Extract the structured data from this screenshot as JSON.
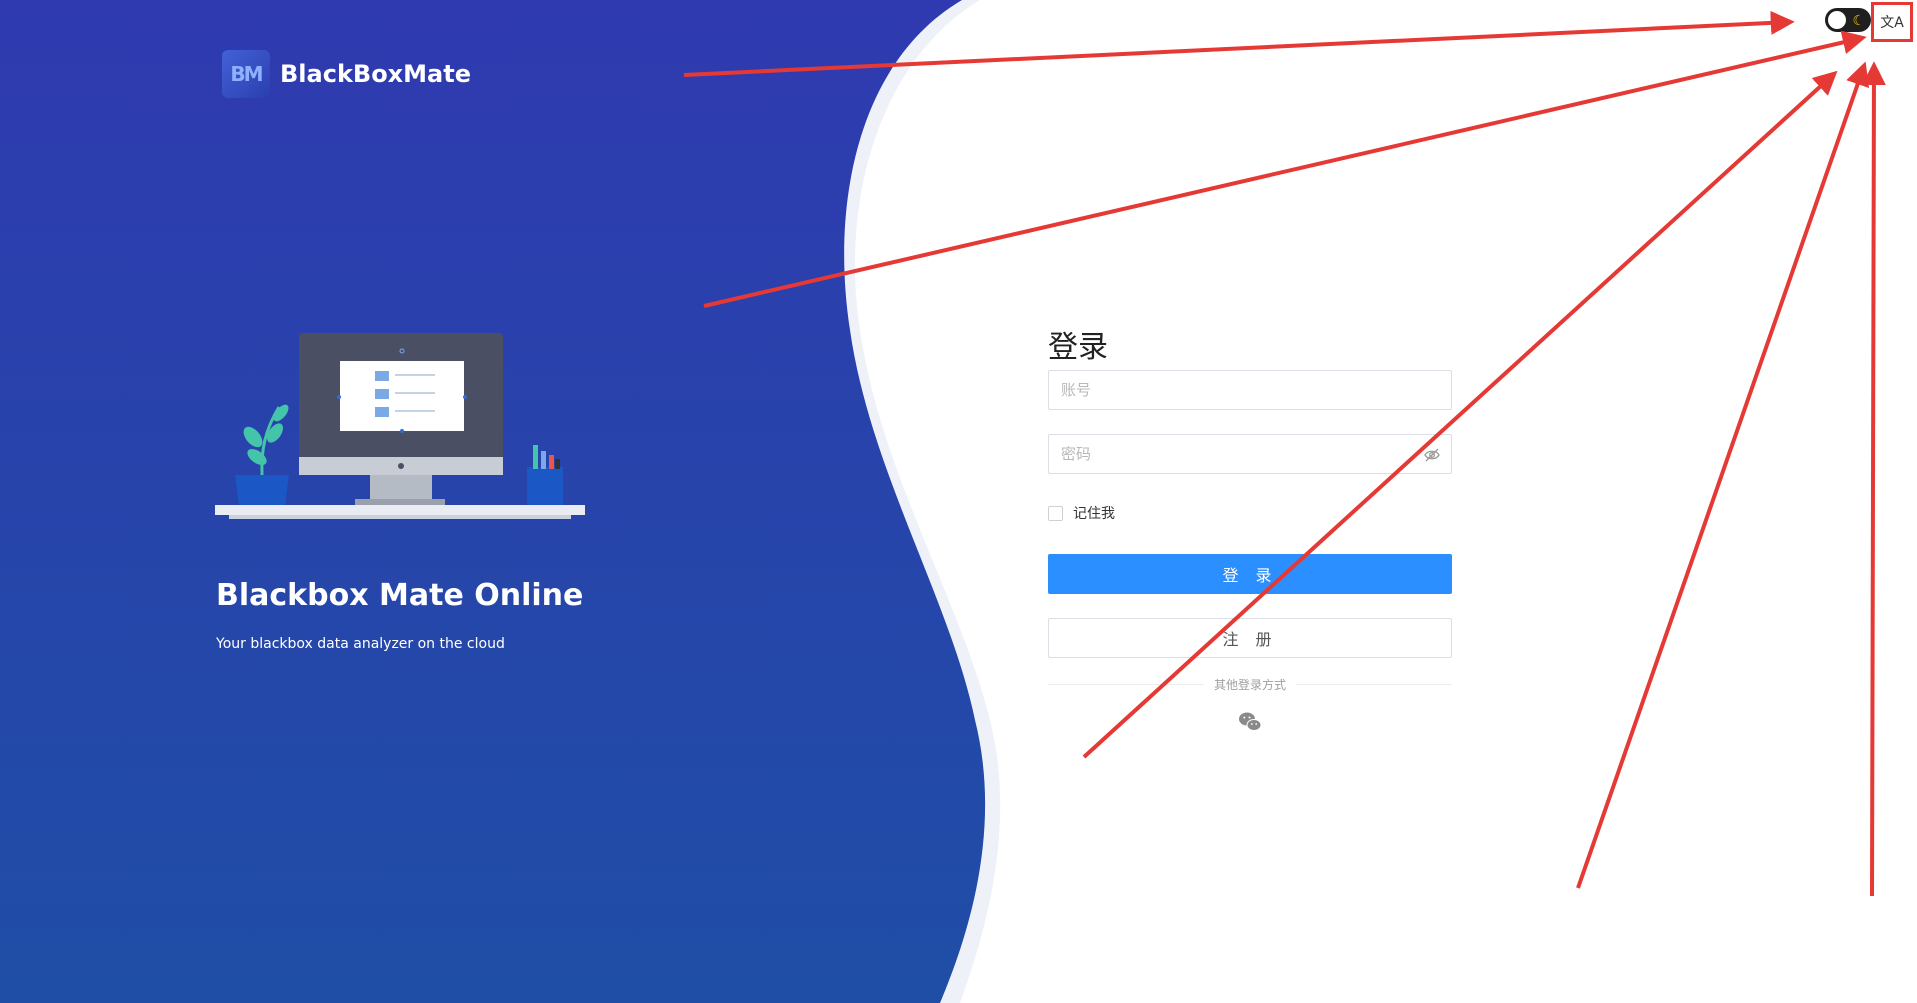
{
  "brand": {
    "logo_text": "BM",
    "name": "BlackBoxMate"
  },
  "hero": {
    "title": "Blackbox Mate Online",
    "subtitle": "Your blackbox data analyzer on the cloud"
  },
  "top_controls": {
    "theme_toggle_icon": "moon-icon",
    "language_icon_glyph": "文A"
  },
  "login": {
    "title": "登录",
    "account_placeholder": "账号",
    "password_placeholder": "密码",
    "remember_label": "记住我",
    "login_button": "登 录",
    "register_button": "注 册",
    "other_methods_label": "其他登录方式"
  },
  "colors": {
    "panel_blue_top": "#2f3ab0",
    "panel_blue_bottom": "#1f4ea6",
    "primary_button": "#2b8fff",
    "annotation_red": "#e53935"
  }
}
